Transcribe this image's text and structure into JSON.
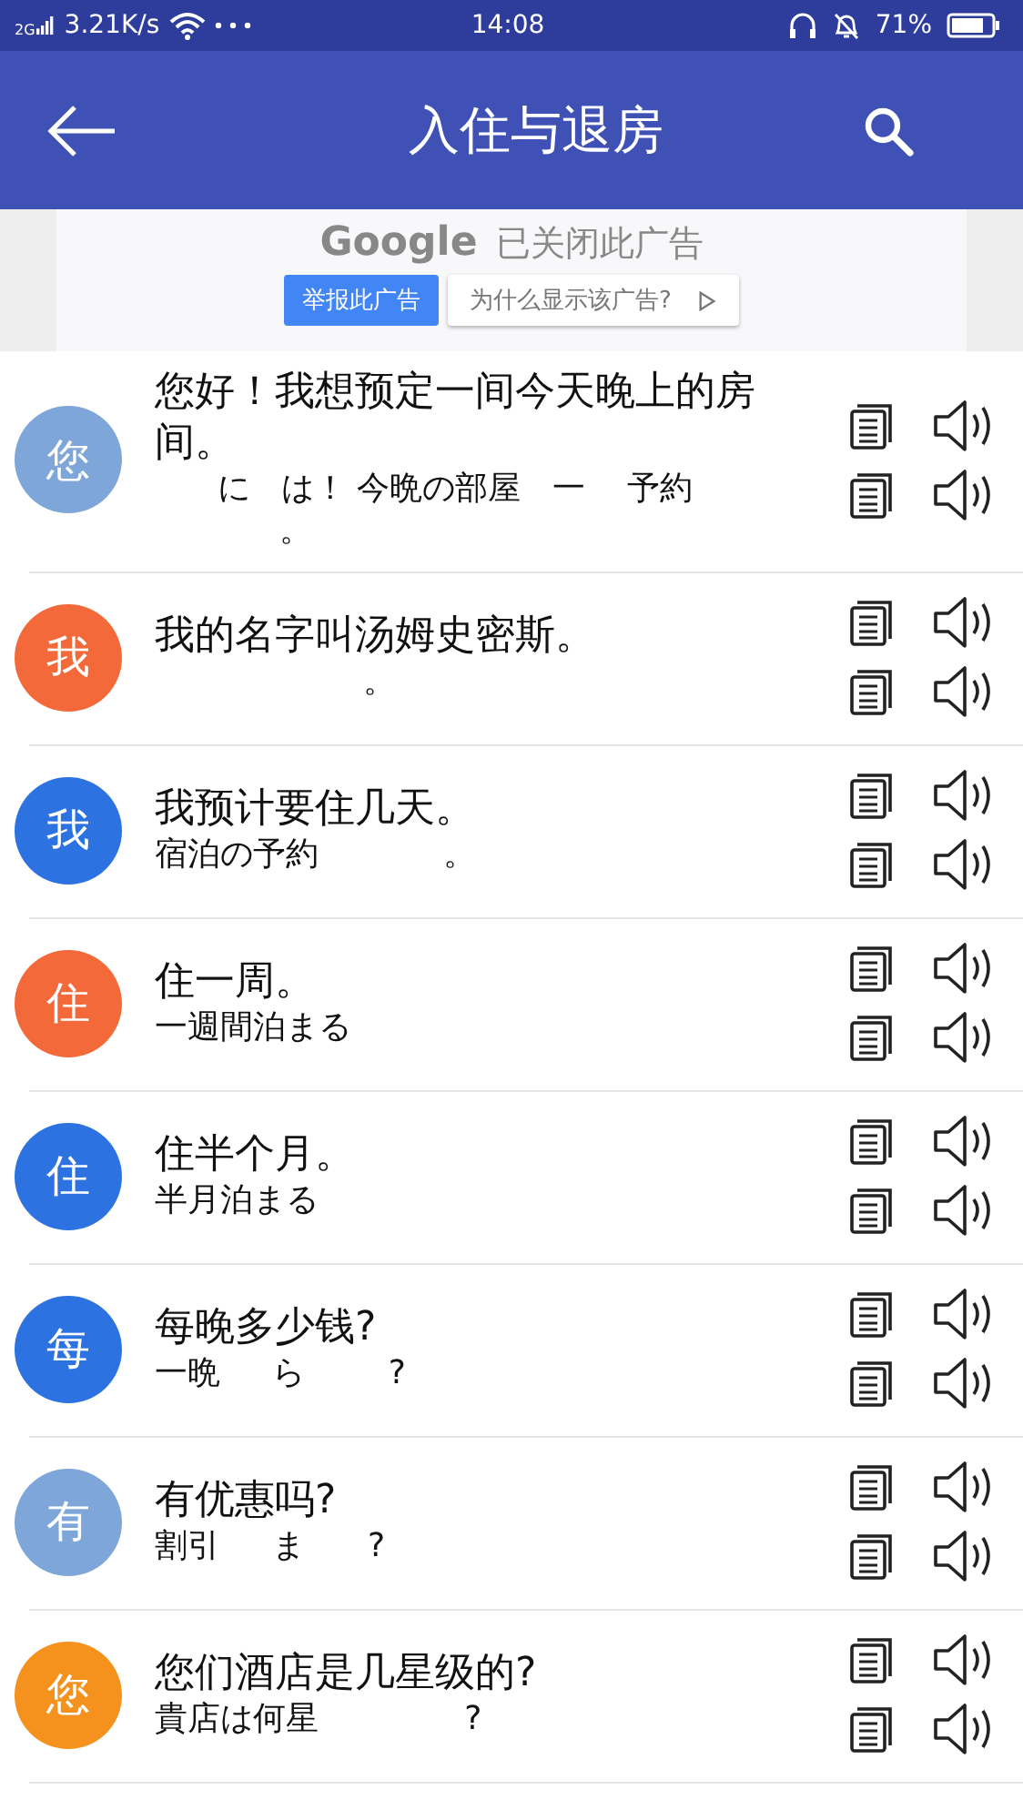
{
  "status_bar": {
    "network": "2G",
    "speed": "3.21K/s",
    "time": "14:08",
    "battery": "71%"
  },
  "app_bar": {
    "title": "入住与退房"
  },
  "ad": {
    "brand": "Google",
    "message": "已关闭此广告",
    "report_button": "举报此广告",
    "why_button": "为什么显示该广告?"
  },
  "phrases": [
    {
      "badge": "您",
      "color": "#7ea6d8",
      "chinese": "您好！我想预定一间今天晚上的房间。",
      "japanese": "      に   は！ 今晩の部屋   一    予約",
      "japanese_extra": "            。"
    },
    {
      "badge": "我",
      "color": "#f4693a",
      "chinese": "我的名字叫汤姆史密斯。",
      "japanese": "                    。"
    },
    {
      "badge": "我",
      "color": "#2c72e0",
      "chinese": "我预计要住几天。",
      "japanese": "宿泊の予約            。"
    },
    {
      "badge": "住",
      "color": "#f4693a",
      "chinese": "住一周。",
      "japanese": "一週間泊まる"
    },
    {
      "badge": "住",
      "color": "#2c72e0",
      "chinese": "住半个月。",
      "japanese": "半月泊まる"
    },
    {
      "badge": "每",
      "color": "#2c72e0",
      "chinese": "每晚多少钱?",
      "japanese": "一晩     ら        ?"
    },
    {
      "badge": "有",
      "color": "#7ea6d8",
      "chinese": "有优惠吗?",
      "japanese": "割引     ま      ?"
    },
    {
      "badge": "您",
      "color": "#f5921e",
      "chinese": "您们酒店是几星级的?",
      "japanese": "貴店は何星              ?"
    }
  ]
}
